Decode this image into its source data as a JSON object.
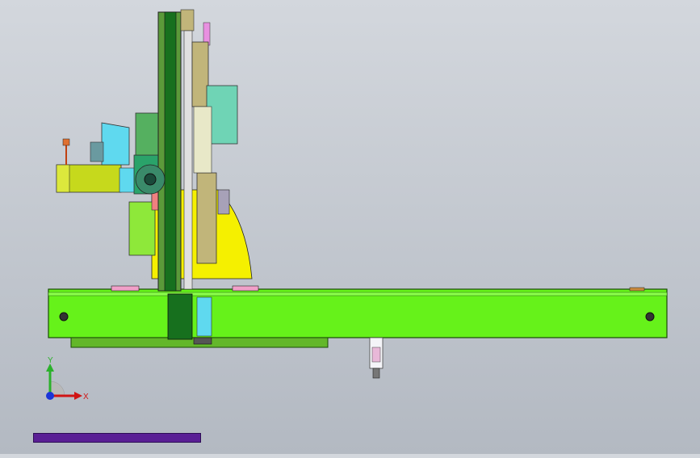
{
  "view": {
    "triad": {
      "x_label": "X",
      "y_label": "Y"
    },
    "colors": {
      "background_top": "#d3d7dd",
      "background_bottom": "#b3b9c2",
      "beam": "#66f21a",
      "beam_shadow": "#63b72a",
      "column": "#17701e",
      "carriage": "#c1b57a",
      "yellow_base": "#f5f000",
      "motor": "#c6d91c",
      "cyan": "#5fd9ef",
      "teal": "#6fd4b5",
      "magenta": "#c218d6",
      "pink": "#f0a0c8",
      "progress": "#4a1a80"
    },
    "progress": {
      "fraction": 1.0
    }
  }
}
